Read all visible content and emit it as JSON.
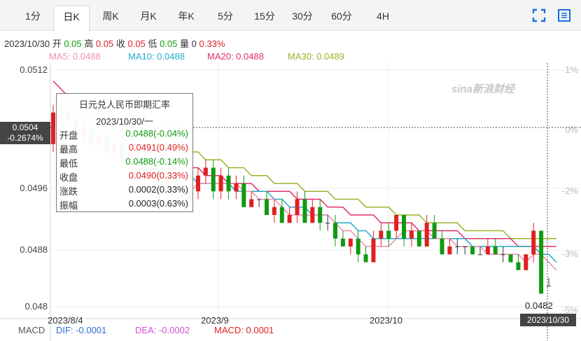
{
  "tabs": [
    {
      "label": "1分",
      "active": false
    },
    {
      "label": "日K",
      "active": true
    },
    {
      "label": "周K",
      "active": false
    },
    {
      "label": "月K",
      "active": false
    },
    {
      "label": "年K",
      "active": false
    },
    {
      "label": "5分",
      "active": false
    },
    {
      "label": "15分",
      "active": false
    },
    {
      "label": "30分",
      "active": false
    },
    {
      "label": "60分",
      "active": false
    },
    {
      "label": "4H",
      "active": false
    }
  ],
  "toolbar": {
    "fullscreen_icon": "fullscreen-icon",
    "settings_icon": "settings-icon"
  },
  "info": {
    "date": "2023/10/30",
    "open_label": "开",
    "open": "0.05",
    "high_label": "高",
    "high": "0.05",
    "close_label": "收",
    "close": "0.05",
    "low_label": "低",
    "low": "0.05",
    "volume_label": "量",
    "volume": "0",
    "change": "0.33%"
  },
  "ma": {
    "ma5": "MA5: 0.0488",
    "ma10": "MA10: 0.0488",
    "ma20": "MA20: 0.0488",
    "ma30": "MA30: 0.0489"
  },
  "macd": {
    "label": "MACD",
    "dif": "DIF: -0.0001",
    "dea": "DEA: -0.0002",
    "macd": "MACD: 0.0001"
  },
  "tooltip": {
    "title": "日元兑人民币即期汇率",
    "date": "2023/10/30/一",
    "rows": [
      {
        "label": "开盘",
        "value": "0.0488(-0.04%)"
      },
      {
        "label": "最高",
        "value": "0.0491(0.49%)"
      },
      {
        "label": "最低",
        "value": "0.0488(-0.14%)"
      },
      {
        "label": "收盘",
        "value": "0.0490(0.33%)"
      },
      {
        "label": "涨跌",
        "value": "0.0002(0.33%)"
      },
      {
        "label": "振幅",
        "value": "0.0003(0.63%)"
      }
    ]
  },
  "crosshair": {
    "price": "0.0504",
    "percent": "-0.2674%",
    "date": "2023/10/30"
  },
  "watermark": "sina新浪财经",
  "colors": {
    "up": "#e02020",
    "down": "#119911",
    "ma5": "#ef8fb0",
    "ma10": "#22aacc",
    "ma20": "#e0306a",
    "ma30": "#99b32a"
  },
  "chart_data": {
    "type": "candlestick",
    "yaxis_ticks": [
      "0.0512",
      "0.0496",
      "0.0488",
      "0.048"
    ],
    "right_axis_ticks": [
      "1%",
      "0%",
      "-2%",
      "-3%",
      "-5%"
    ],
    "x_ticks": [
      "2023/8/4",
      "2023/9",
      "2023/10"
    ],
    "min_label": "0.0482",
    "ylim": [
      0.048,
      0.0512
    ],
    "candles": [
      [
        0.0501,
        0.0505,
        0.0506,
        0.05
      ],
      [
        0.0505,
        0.0505,
        0.0506,
        0.0504
      ],
      [
        0.0505,
        0.0504,
        0.0506,
        0.0503
      ],
      [
        0.0504,
        0.0502,
        0.0505,
        0.0501
      ],
      [
        0.0502,
        0.0503,
        0.0504,
        0.0501
      ],
      [
        0.0503,
        0.0501,
        0.0504,
        0.05
      ],
      [
        0.0501,
        0.0502,
        0.0503,
        0.05
      ],
      [
        0.0502,
        0.05,
        0.0503,
        0.0499
      ],
      [
        0.05,
        0.0501,
        0.0502,
        0.0499
      ],
      [
        0.0501,
        0.0499,
        0.0502,
        0.0498
      ],
      [
        0.0499,
        0.05,
        0.0501,
        0.0498
      ],
      [
        0.05,
        0.0499,
        0.0501,
        0.0497
      ],
      [
        0.0499,
        0.0497,
        0.05,
        0.0496
      ],
      [
        0.0497,
        0.0498,
        0.0499,
        0.0496
      ],
      [
        0.0498,
        0.0495,
        0.0499,
        0.0494
      ],
      [
        0.0495,
        0.0497,
        0.0498,
        0.0494
      ],
      [
        0.0497,
        0.0496,
        0.0498,
        0.0495
      ],
      [
        0.0496,
        0.0494,
        0.0497,
        0.0493
      ],
      [
        0.0494,
        0.0495,
        0.0496,
        0.0493
      ],
      [
        0.0495,
        0.0497,
        0.0498,
        0.0494
      ],
      [
        0.0497,
        0.0498,
        0.0499,
        0.0496
      ],
      [
        0.0498,
        0.0495,
        0.0499,
        0.0494
      ],
      [
        0.0495,
        0.0497,
        0.0498,
        0.0494
      ],
      [
        0.0497,
        0.0495,
        0.0498,
        0.0494
      ],
      [
        0.0495,
        0.0496,
        0.0497,
        0.0494
      ],
      [
        0.0496,
        0.0493,
        0.0497,
        0.0493
      ],
      [
        0.0493,
        0.0494,
        0.0495,
        0.0493
      ],
      [
        0.0494,
        0.0494,
        0.0494,
        0.0493
      ],
      [
        0.0494,
        0.0492,
        0.0495,
        0.0492
      ],
      [
        0.0492,
        0.0493,
        0.0494,
        0.0491
      ],
      [
        0.0493,
        0.0491,
        0.0494,
        0.0491
      ],
      [
        0.0491,
        0.0492,
        0.0493,
        0.0491
      ],
      [
        0.0492,
        0.0494,
        0.0495,
        0.0491
      ],
      [
        0.0494,
        0.0491,
        0.0495,
        0.0491
      ],
      [
        0.0491,
        0.0493,
        0.0494,
        0.0491
      ],
      [
        0.0493,
        0.0491,
        0.0494,
        0.049
      ],
      [
        0.0491,
        0.0491,
        0.0492,
        0.049
      ],
      [
        0.0491,
        0.0489,
        0.0492,
        0.0488
      ],
      [
        0.0489,
        0.0488,
        0.049,
        0.0488
      ],
      [
        0.0488,
        0.0489,
        0.0489,
        0.0487
      ],
      [
        0.0489,
        0.0487,
        0.049,
        0.0486
      ],
      [
        0.0487,
        0.0486,
        0.0488,
        0.0486
      ],
      [
        0.0486,
        0.0489,
        0.049,
        0.0486
      ],
      [
        0.0489,
        0.049,
        0.0491,
        0.0488
      ],
      [
        0.049,
        0.0489,
        0.0491,
        0.0488
      ],
      [
        0.049,
        0.0492,
        0.0492,
        0.0489
      ],
      [
        0.0492,
        0.0489,
        0.0492,
        0.0488
      ],
      [
        0.0489,
        0.049,
        0.0491,
        0.0488
      ],
      [
        0.049,
        0.0488,
        0.049,
        0.0488
      ],
      [
        0.0488,
        0.0491,
        0.0492,
        0.0488
      ],
      [
        0.0491,
        0.0489,
        0.0492,
        0.0489
      ],
      [
        0.0489,
        0.0487,
        0.049,
        0.0487
      ],
      [
        0.0487,
        0.0488,
        0.0489,
        0.0487
      ],
      [
        0.0488,
        0.0488,
        0.0489,
        0.0487
      ],
      [
        0.0488,
        0.0488,
        0.0488,
        0.0487
      ],
      [
        0.0488,
        0.0487,
        0.0488,
        0.0487
      ],
      [
        0.0487,
        0.0487,
        0.0488,
        0.0487
      ],
      [
        0.0487,
        0.0488,
        0.0489,
        0.0487
      ],
      [
        0.0488,
        0.0487,
        0.0489,
        0.0487
      ],
      [
        0.0487,
        0.0487,
        0.0488,
        0.0486
      ],
      [
        0.0487,
        0.0486,
        0.0487,
        0.0486
      ],
      [
        0.0486,
        0.0485,
        0.0487,
        0.0485
      ],
      [
        0.0485,
        0.0487,
        0.0487,
        0.0485
      ],
      [
        0.0487,
        0.049,
        0.0491,
        0.0486
      ],
      [
        0.049,
        0.0482,
        0.049,
        0.0482
      ],
      [
        0.0483,
        0.0483,
        0.0484,
        0.0483
      ]
    ],
    "ma5": [
      null,
      null,
      null,
      null,
      0.0504,
      0.0503,
      0.0502,
      0.0502,
      0.0501,
      0.0501,
      0.05,
      0.05,
      0.0499,
      0.0499,
      0.0498,
      0.0497,
      0.0497,
      0.0496,
      0.0495,
      0.0496,
      0.0496,
      0.0496,
      0.0496,
      0.0496,
      0.0496,
      0.0495,
      0.0495,
      0.0494,
      0.0494,
      0.0494,
      0.0493,
      0.0492,
      0.0492,
      0.0492,
      0.0492,
      0.0492,
      0.0492,
      0.0491,
      0.049,
      0.049,
      0.0489,
      0.0488,
      0.0488,
      0.0488,
      0.0488,
      0.0489,
      0.049,
      0.049,
      0.049,
      0.049,
      0.0489,
      0.0489,
      0.0489,
      0.0488,
      0.0488,
      0.0488,
      0.0488,
      0.0487,
      0.0487,
      0.0487,
      0.0487,
      0.0487,
      0.0486,
      0.0487,
      0.0487,
      0.0486,
      0.0485
    ],
    "ma10": [
      null,
      null,
      null,
      null,
      null,
      null,
      null,
      null,
      null,
      0.0502,
      0.0502,
      0.0501,
      0.0501,
      0.05,
      0.0499,
      0.0499,
      0.0498,
      0.0497,
      0.0497,
      0.0496,
      0.0496,
      0.0496,
      0.0496,
      0.0496,
      0.0495,
      0.0495,
      0.0495,
      0.0495,
      0.0495,
      0.0494,
      0.0494,
      0.0493,
      0.0493,
      0.0493,
      0.0492,
      0.0492,
      0.0492,
      0.0491,
      0.0491,
      0.0491,
      0.049,
      0.049,
      0.0489,
      0.0489,
      0.0489,
      0.0489,
      0.0489,
      0.0489,
      0.0489,
      0.0489,
      0.0489,
      0.0489,
      0.0489,
      0.0489,
      0.0489,
      0.0488,
      0.0488,
      0.0488,
      0.0488,
      0.0488,
      0.0488,
      0.0488,
      0.0488,
      0.0488,
      0.0487,
      0.0487,
      0.0486
    ],
    "ma20": [
      0.0509,
      0.0508,
      0.0507,
      0.0506,
      0.0505,
      0.0504,
      0.0503,
      0.0503,
      0.0502,
      0.0502,
      0.0501,
      0.0501,
      0.05,
      0.05,
      0.05,
      0.0499,
      0.0499,
      0.0498,
      0.0498,
      0.0498,
      0.0497,
      0.0497,
      0.0497,
      0.0496,
      0.0496,
      0.0496,
      0.0496,
      0.0495,
      0.0495,
      0.0495,
      0.0495,
      0.0495,
      0.0494,
      0.0494,
      0.0494,
      0.0494,
      0.0493,
      0.0493,
      0.0493,
      0.0492,
      0.0492,
      0.0492,
      0.0492,
      0.0491,
      0.0491,
      0.0491,
      0.0491,
      0.0491,
      0.049,
      0.049,
      0.049,
      0.049,
      0.049,
      0.049,
      0.0489,
      0.0489,
      0.0489,
      0.0489,
      0.0489,
      0.0489,
      0.0489,
      0.0488,
      0.0488,
      0.0488,
      0.0488,
      0.0488,
      0.0488
    ],
    "ma30": [
      null,
      null,
      null,
      null,
      null,
      null,
      null,
      null,
      null,
      null,
      null,
      0.0503,
      0.0503,
      0.0502,
      0.0502,
      0.0501,
      0.0501,
      0.05,
      0.05,
      0.05,
      0.0499,
      0.0499,
      0.0499,
      0.0498,
      0.0498,
      0.0498,
      0.0497,
      0.0497,
      0.0497,
      0.0496,
      0.0496,
      0.0496,
      0.0496,
      0.0495,
      0.0495,
      0.0495,
      0.0495,
      0.0494,
      0.0494,
      0.0494,
      0.0494,
      0.0493,
      0.0493,
      0.0493,
      0.0493,
      0.0492,
      0.0492,
      0.0492,
      0.0492,
      0.0491,
      0.0491,
      0.0491,
      0.0491,
      0.0491,
      0.049,
      0.049,
      0.049,
      0.049,
      0.049,
      0.049,
      0.0489,
      0.0489,
      0.0489,
      0.0489,
      0.0489,
      0.0489,
      0.0489
    ]
  }
}
